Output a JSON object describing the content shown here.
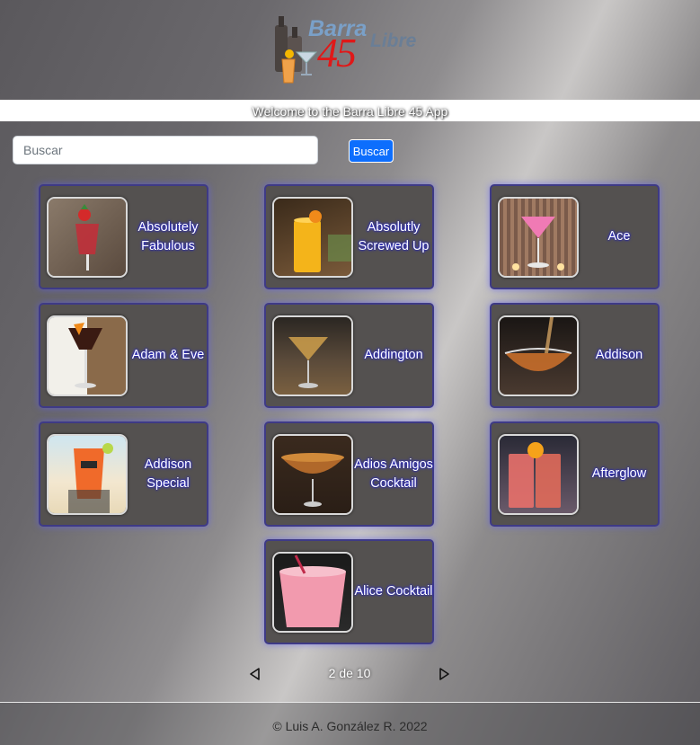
{
  "app": {
    "logo_barra": "Barra",
    "logo_number": "45",
    "logo_libre": "Libre",
    "welcome": "Welcome to the Barra Libre 45 App"
  },
  "search": {
    "placeholder": "Buscar",
    "button_label": "Buscar"
  },
  "cocktails": [
    {
      "name": "Absolutely Fabulous",
      "image": "champagne-flute-strawberry"
    },
    {
      "name": "Absolutly Screwed Up",
      "image": "orange-highball"
    },
    {
      "name": "Ace",
      "image": "pink-martini"
    },
    {
      "name": "Adam & Eve",
      "image": "dark-cocktail-coupe"
    },
    {
      "name": "Addington",
      "image": "amber-martini"
    },
    {
      "name": "Addison",
      "image": "amber-bowl-pour"
    },
    {
      "name": "Addison Special",
      "image": "orange-plastic-cup-beach"
    },
    {
      "name": "Adios Amigos Cocktail",
      "image": "amber-coupe"
    },
    {
      "name": "Afterglow",
      "image": "pink-highballs-orange"
    },
    {
      "name": "Alice Cocktail",
      "image": "pink-frothy-glass"
    }
  ],
  "pagination": {
    "text": "2 de 10",
    "prev_icon": "triangle-left-icon",
    "next_icon": "triangle-right-icon"
  },
  "footer": {
    "text": "© Luis A. González R. 2022"
  },
  "colors": {
    "card_bg": "#545150",
    "card_border": "#3e3a86",
    "button_blue": "#0d6efd",
    "logo_red": "#e01818",
    "logo_blue": "#7aa0c8"
  }
}
